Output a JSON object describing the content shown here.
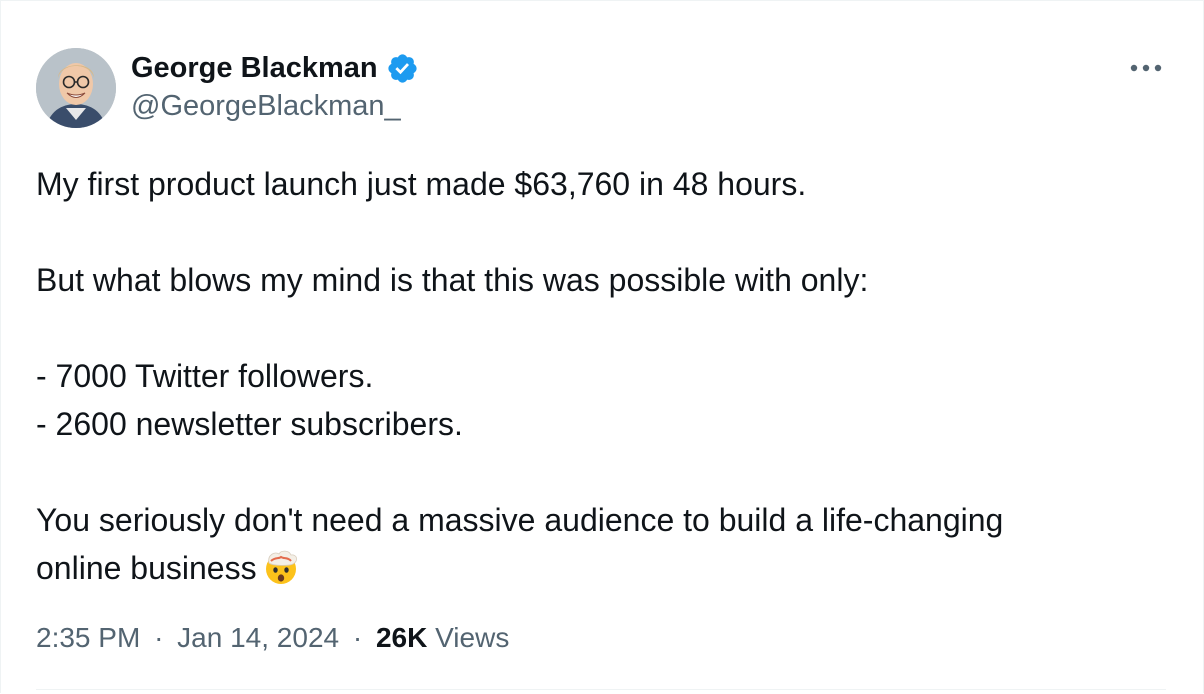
{
  "author": {
    "name": "George Blackman",
    "handle": "@GeorgeBlackman_",
    "verified": true,
    "verified_color": "#1d9bf0"
  },
  "tweet": {
    "line1": "My first product launch just made $63,760 in 48 hours.",
    "line2": "But what blows my mind is that this was possible with only:",
    "line3": "- 7000 Twitter followers.",
    "line4": "- 2600 newsletter subscribers.",
    "line5": "You seriously don't need a massive audience to build a life-changing",
    "line6": "online business",
    "emoji": "exploding-head-emoji"
  },
  "meta": {
    "time": "2:35 PM",
    "date": "Jan 14, 2024",
    "separator": "·",
    "views_count": "26K",
    "views_label": "Views"
  },
  "icons": {
    "more": "more-options-icon",
    "verified": "verified-badge-icon"
  },
  "colors": {
    "text": "#0f1419",
    "secondary": "#536471",
    "accent": "#1d9bf0",
    "border": "#eff3f4"
  }
}
